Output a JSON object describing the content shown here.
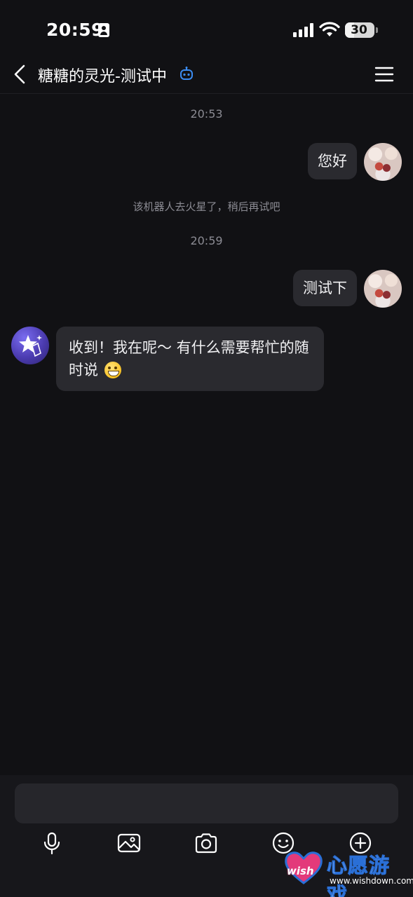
{
  "status_bar": {
    "time": "20:59",
    "battery": "30",
    "battery_level_percent": 30
  },
  "header": {
    "title": "糖糖的灵光-测试中",
    "back_icon": "chevron-left-icon",
    "bot_icon": "robot-icon",
    "menu_icon": "hamburger-menu-icon"
  },
  "messages": [
    {
      "type": "timestamp",
      "text": "20:53"
    },
    {
      "type": "user",
      "text": "您好"
    },
    {
      "type": "system",
      "text": "该机器人去火星了，稍后再试吧"
    },
    {
      "type": "timestamp",
      "text": "20:59"
    },
    {
      "type": "user",
      "text": "测试下"
    },
    {
      "type": "bot",
      "text": "收到！我在呢～ 有什么需要帮忙的随时说",
      "emoji": "grinning-face-emoji"
    }
  ],
  "composer": {
    "input_value": "",
    "tools": [
      "microphone-icon",
      "image-icon",
      "camera-icon",
      "emoji-icon",
      "plus-icon"
    ]
  },
  "watermark": {
    "badge_text": "wish",
    "brand": "心愿游戏",
    "url": "www.wishdown.com"
  },
  "colors": {
    "background": "#111114",
    "bubble": "#2a2a2f",
    "bot_accent": "#3b8cf2"
  }
}
